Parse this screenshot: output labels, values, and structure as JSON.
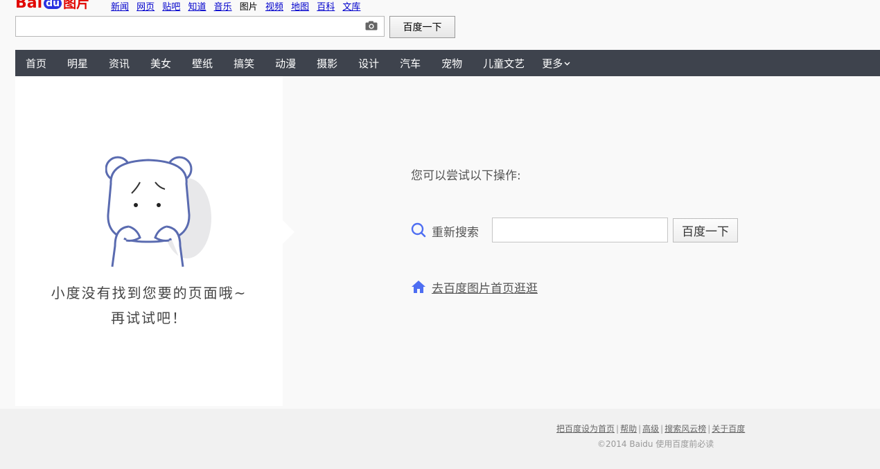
{
  "brand": {
    "logo_bai": "Bai",
    "logo_du": "du",
    "logo_pic": "图片"
  },
  "topnav": [
    {
      "label": "新闻",
      "current": false
    },
    {
      "label": "网页",
      "current": false
    },
    {
      "label": "贴吧",
      "current": false
    },
    {
      "label": "知道",
      "current": false
    },
    {
      "label": "音乐",
      "current": false
    },
    {
      "label": "图片",
      "current": true
    },
    {
      "label": "视频",
      "current": false
    },
    {
      "label": "地图",
      "current": false
    },
    {
      "label": "百科",
      "current": false
    },
    {
      "label": "文库",
      "current": false
    }
  ],
  "search": {
    "value": "",
    "placeholder": "",
    "button": "百度一下",
    "camera_icon": "camera-icon"
  },
  "categories": [
    "首页",
    "明星",
    "资讯",
    "美女",
    "壁纸",
    "搞笑",
    "动漫",
    "摄影",
    "设计",
    "汽车",
    "宠物",
    "儿童文艺",
    "更多"
  ],
  "error": {
    "line1": "小度没有找到您要的页面哦~",
    "line2": "再试试吧！"
  },
  "tips": {
    "title": "您可以尝试以下操作:",
    "research_label": "重新搜索",
    "research_value": "",
    "research_button": "百度一下",
    "home_link": "去百度图片首页逛逛"
  },
  "colors": {
    "nav_bg": "#3e434d",
    "accent_blue": "#4e6ef2",
    "logo_red": "#e10601"
  },
  "footer": {
    "links": [
      "把百度设为首页",
      "帮助",
      "高级",
      "搜索风云榜",
      "关于百度"
    ],
    "copyright": "©2014 Baidu 使用百度前必读"
  }
}
